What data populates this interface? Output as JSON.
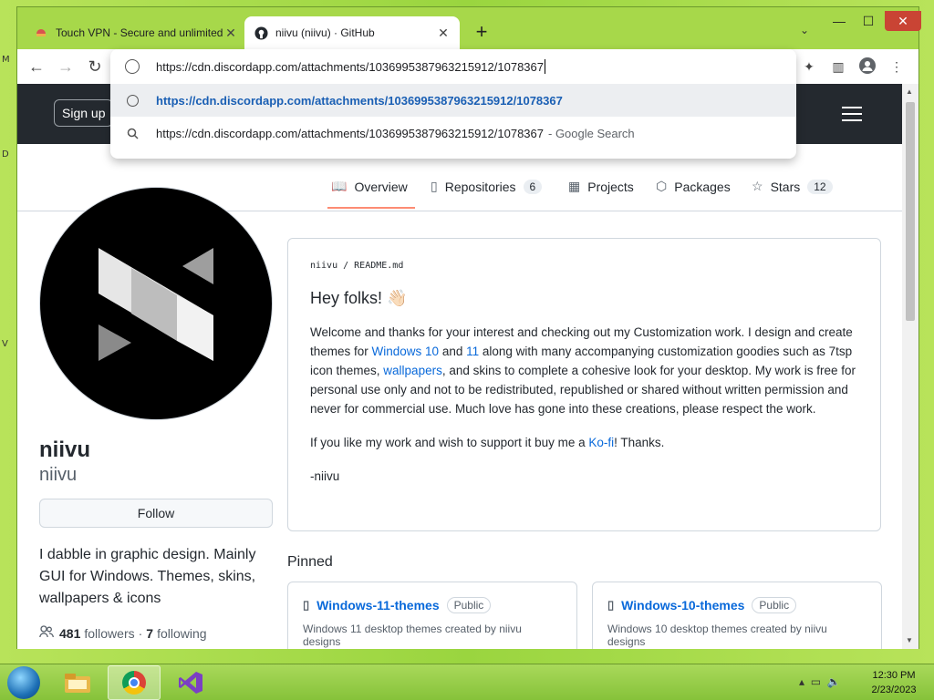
{
  "desktop": {
    "glyphs": [
      "M",
      "D",
      "V"
    ]
  },
  "browser": {
    "tabs": [
      {
        "title": "Touch VPN - Secure and unlimited",
        "icon": "touchvpn-icon"
      },
      {
        "title": "niivu (niivu) · GitHub",
        "icon": "github-icon"
      }
    ],
    "new_tab": "+",
    "tab_search": "⌄"
  },
  "omnibox": {
    "url": "https://cdn.discordapp.com/attachments/1036995387963215912/1078367",
    "suggestion_url": "https://cdn.discordapp.com/attachments/1036995387963215912/1078367",
    "search_text": "https://cdn.discordapp.com/attachments/1036995387963215912/1078367",
    "search_suffix": "- Google Search"
  },
  "github": {
    "signup": "Sign up",
    "tabs": [
      {
        "label": "Overview",
        "icon": "book-icon",
        "count": ""
      },
      {
        "label": "Repositories",
        "icon": "repo-icon",
        "count": "6"
      },
      {
        "label": "Projects",
        "icon": "table-icon",
        "count": ""
      },
      {
        "label": "Packages",
        "icon": "package-icon",
        "count": ""
      },
      {
        "label": "Stars",
        "icon": "star-icon",
        "count": "12"
      }
    ],
    "profile": {
      "name": "niivu",
      "login": "niivu",
      "follow": "Follow",
      "bio": "I dabble in graphic design. Mainly GUI for Windows. Themes, skins, wallpapers & icons",
      "followers": "481",
      "followers_label": "followers",
      "following": "7",
      "following_label": "following",
      "separator": "·"
    },
    "readme": {
      "path": "niivu / README.md",
      "heading": "Hey folks! 👋🏻",
      "p1_a": "Welcome and thanks for your interest and checking out my Customization work. I design and create themes for ",
      "p1_link1": "Windows 10",
      "p1_b": " and ",
      "p1_link2": "11",
      "p1_c": " along with many accompanying customization goodies such as 7tsp icon themes, ",
      "p1_link3": "wallpapers",
      "p1_d": ", and skins to complete a cohesive look for your desktop. My work is free for personal use only and not to be redistributed, republished or shared without written permission and never for commercial use. Much love has gone into these creations, please respect the work.",
      "p2_a": "If you like my work and wish to support it buy me a ",
      "p2_link": "Ko-fi",
      "p2_b": "! Thanks.",
      "p3": "-niivu"
    },
    "pinned": {
      "heading": "Pinned",
      "repos": [
        {
          "name": "Windows-11-themes",
          "badge": "Public",
          "desc": "Windows 11 desktop themes created by niivu designs"
        },
        {
          "name": "Windows-10-themes",
          "badge": "Public",
          "desc": "Windows 10 desktop themes created by niivu designs"
        }
      ]
    }
  },
  "taskbar": {
    "time": "12:30 PM",
    "date": "2/23/2023"
  },
  "colors": {
    "desktop_green": "#9ad53f",
    "github_header": "#24292f",
    "link": "#0969da",
    "active_tab_underline": "#fd8c73"
  }
}
